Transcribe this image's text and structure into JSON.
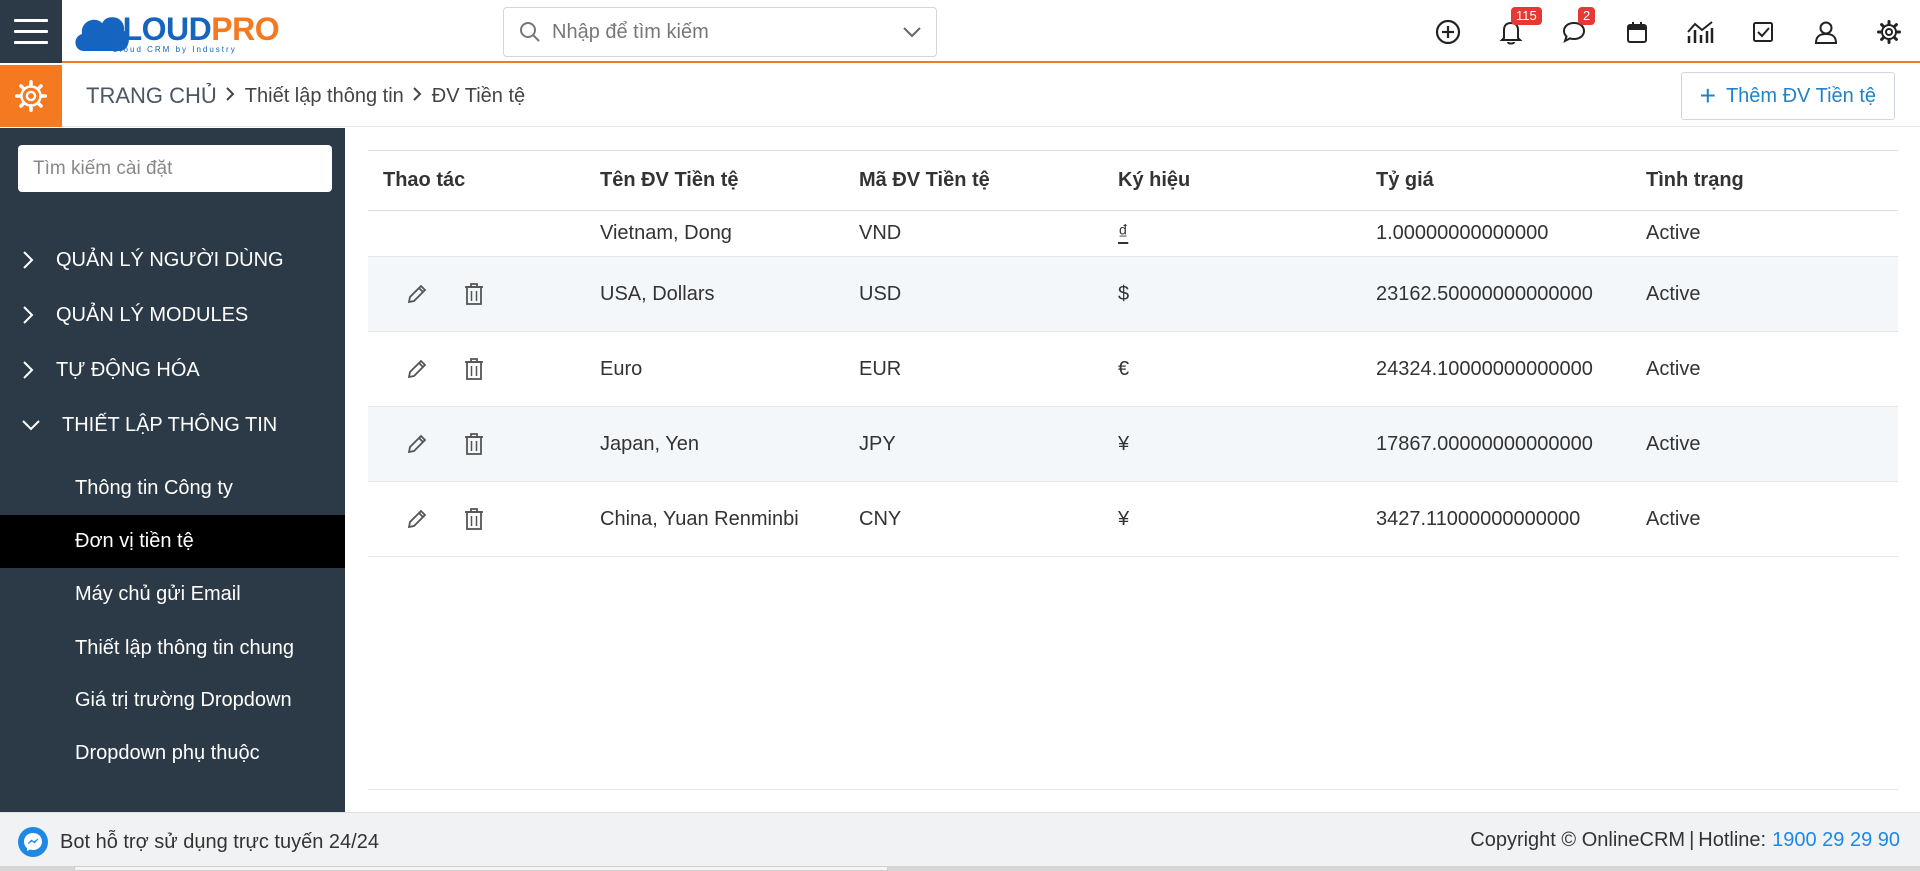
{
  "logo": {
    "part1": "CLOUD",
    "part2": "PRO",
    "tagline": "Cloud CRM by Industry"
  },
  "search": {
    "placeholder": "Nhập để tìm kiếm"
  },
  "badges": {
    "notifications": "115",
    "messages": "2"
  },
  "breadcrumb": {
    "home": "TRANG CHỦ",
    "level1": "Thiết lập thông tin",
    "level2": "ĐV Tiền tệ"
  },
  "add_button": {
    "label": "Thêm ĐV Tiền tệ"
  },
  "sidebar": {
    "search_placeholder": "Tìm kiếm cài đặt",
    "groups": [
      {
        "label": "QUẢN LÝ NGƯỜI DÙNG",
        "expanded": false
      },
      {
        "label": "QUẢN LÝ MODULES",
        "expanded": false
      },
      {
        "label": "TỰ ĐỘNG HÓA",
        "expanded": false
      },
      {
        "label": "THIẾT LẬP THÔNG TIN",
        "expanded": true
      }
    ],
    "subitems": [
      {
        "label": "Thông tin Công ty",
        "active": false
      },
      {
        "label": "Đơn vị tiền tệ",
        "active": true
      },
      {
        "label": "Máy chủ gửi Email",
        "active": false
      },
      {
        "label": "Thiết lập thông tin chung",
        "active": false
      },
      {
        "label": "Giá trị trường Dropdown",
        "active": false
      },
      {
        "label": "Dropdown phụ thuộc",
        "active": false
      }
    ]
  },
  "table": {
    "headers": [
      "Thao tác",
      "Tên ĐV Tiền tệ",
      "Mã ĐV Tiền tệ",
      "Ký hiệu",
      "Tỷ giá",
      "Tình trạng"
    ],
    "rows": [
      {
        "name": "Vietnam, Dong",
        "code": "VND",
        "symbol": "₫",
        "rate": "1.00000000000000",
        "status": "Active",
        "editable": false
      },
      {
        "name": "USA, Dollars",
        "code": "USD",
        "symbol": "$",
        "rate": "23162.50000000000000",
        "status": "Active",
        "editable": true
      },
      {
        "name": "Euro",
        "code": "EUR",
        "symbol": "€",
        "rate": "24324.10000000000000",
        "status": "Active",
        "editable": true
      },
      {
        "name": "Japan, Yen",
        "code": "JPY",
        "symbol": "¥",
        "rate": "17867.00000000000000",
        "status": "Active",
        "editable": true
      },
      {
        "name": "China, Yuan Renminbi",
        "code": "CNY",
        "symbol": "¥",
        "rate": "3427.11000000000000",
        "status": "Active",
        "editable": true
      }
    ]
  },
  "footer": {
    "bot_text": "Bot hỗ trợ sử dụng trực tuyến 24/24",
    "copyright": "Copyright © OnlineCRM",
    "hotline_label": "Hotline:",
    "hotline_number": "1900 29 29 90"
  },
  "icons": [
    "menu-icon",
    "search-icon",
    "chevron-down-icon",
    "plus-circle-icon",
    "bell-icon",
    "chat-icon",
    "calendar-icon",
    "chart-icon",
    "checkbox-icon",
    "user-icon",
    "gear-icon",
    "chevron-right-icon",
    "edit-icon",
    "trash-icon",
    "messenger-icon"
  ],
  "colors": {
    "accent": "#f47920",
    "sidebar": "#2b3a46",
    "link": "#2382c4",
    "badge": "#e53935"
  }
}
